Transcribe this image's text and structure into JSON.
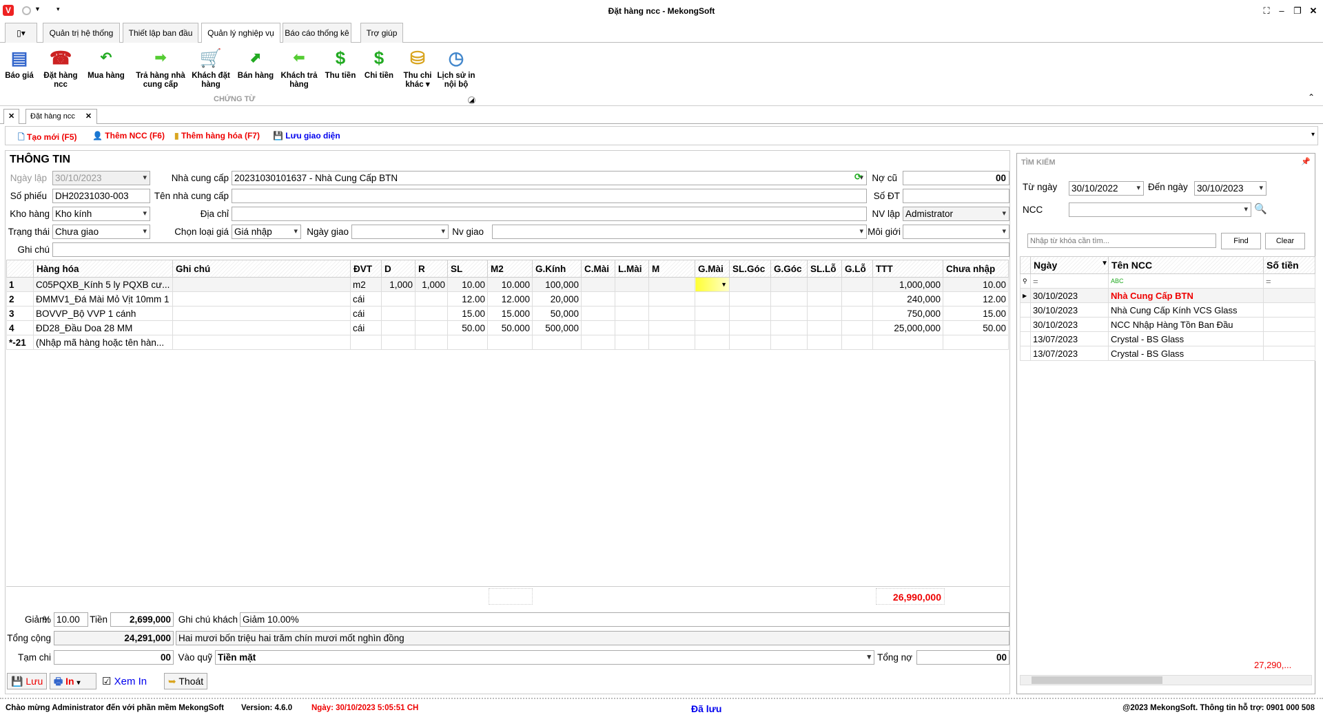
{
  "window": {
    "title": "Đặt hàng ncc - MekongSoft"
  },
  "menu_tabs": [
    "Quản trị hệ thống",
    "Thiết lập ban đầu",
    "Quản lý nghiệp vụ",
    "Báo cáo thống kê",
    "Trợ giúp"
  ],
  "ribbon": {
    "items": [
      {
        "label": "Báo giá",
        "icon": "list-icon"
      },
      {
        "label": "Đặt hàng ncc",
        "icon": "telephone-icon"
      },
      {
        "label": "Mua hàng",
        "icon": "arrow-back-icon"
      },
      {
        "label": "Trả hàng nhà cung cấp",
        "icon": "arrow-right-icon"
      },
      {
        "label": "Khách đặt hàng",
        "icon": "cart-icon"
      },
      {
        "label": "Bán hàng",
        "icon": "arrow-up-icon"
      },
      {
        "label": "Khách trả hàng",
        "icon": "arrow-left-icon"
      },
      {
        "label": "Thu tiền",
        "icon": "dollar-plus-icon"
      },
      {
        "label": "Chi tiền",
        "icon": "dollar-minus-icon"
      },
      {
        "label": "Thu chi khác",
        "icon": "coins-icon"
      },
      {
        "label": "Lịch sử in nội bộ",
        "icon": "history-icon"
      }
    ],
    "group": "CHỨNG TỪ"
  },
  "doc_tab": "Đặt hàng ncc",
  "toolbar": {
    "new": "Tạo mới (F5)",
    "add_ncc": "Thêm NCC (F6)",
    "add_goods": "Thêm hàng hóa (F7)",
    "save_layout": "Lưu giao diện"
  },
  "form": {
    "section": "THÔNG TIN",
    "ngay_lap_label": "Ngày lập",
    "ngay_lap": "30/10/2023",
    "so_phieu_label": "Số phiếu",
    "so_phieu": "DH20231030-003",
    "kho_label": "Kho hàng",
    "kho": "Kho kính",
    "trang_thai_label": "Trạng thái",
    "trang_thai": "Chưa giao",
    "ghi_chu_label": "Ghi chú",
    "ncc_label": "Nhà cung cấp",
    "ncc": "20231030101637 - Nhà Cung Cấp BTN",
    "ten_ncc_label": "Tên nhà cung cấp",
    "dia_chi_label": "Địa chỉ",
    "loai_gia_label": "Chọn loại giá",
    "loai_gia": "Giá nhập",
    "ngay_giao_label": "Ngày giao",
    "nv_giao_label": "Nv giao",
    "no_cu_label": "Nợ cũ",
    "no_cu": "00",
    "so_dt_label": "Số ĐT",
    "nv_lap_label": "NV lập",
    "nv_lap": "Admistrator",
    "moi_gioi_label": "Môi giới"
  },
  "grid": {
    "columns": [
      "",
      "Hàng hóa",
      "Ghi chú",
      "ĐVT",
      "D",
      "R",
      "SL",
      "M2",
      "G.Kính",
      "C.Mài",
      "L.Mài",
      "M",
      "G.Mài",
      "SL.Góc",
      "G.Góc",
      "SL.Lỗ",
      "G.Lỗ",
      "TTT",
      "Chưa nhập"
    ],
    "rows": [
      [
        "1",
        "C05PQXB_Kính 5 ly PQXB cư...",
        "",
        "m2",
        "1,000",
        "1,000",
        "10.00",
        "10.000",
        "100,000",
        "",
        "",
        "",
        "",
        "",
        "",
        "",
        "",
        "1,000,000",
        "10.00"
      ],
      [
        "2",
        "ĐMMV1_Đá Mài Mỏ Vịt 10mm 1",
        "",
        "cái",
        "",
        "",
        "12.00",
        "12.000",
        "20,000",
        "",
        "",
        "",
        "",
        "",
        "",
        "",
        "",
        "240,000",
        "12.00"
      ],
      [
        "3",
        "BOVVP_Bộ VVP 1 cánh",
        "",
        "cái",
        "",
        "",
        "15.00",
        "15.000",
        "50,000",
        "",
        "",
        "",
        "",
        "",
        "",
        "",
        "",
        "750,000",
        "15.00"
      ],
      [
        "4",
        "ĐD28_Đầu Doa 28 MM",
        "",
        "cái",
        "",
        "",
        "50.00",
        "50.000",
        "500,000",
        "",
        "",
        "",
        "",
        "",
        "",
        "",
        "",
        "25,000,000",
        "50.00"
      ]
    ],
    "new_row": [
      "*-21",
      "(Nhập mã hàng hoặc tên hàn..."
    ],
    "total": "26,990,000"
  },
  "summary": {
    "giam_label": "Giảm:",
    "pct_label": "%",
    "giam_pct": "10.00",
    "tien_label": "Tiền",
    "tien": "2,699,000",
    "ghi_chu_khach_label": "Ghi chú khách",
    "ghi_chu_khach": "Giảm 10.00%",
    "tong_cong_label": "Tổng cộng",
    "tong_cong": "24,291,000",
    "bang_chu": "Hai mươi bốn triệu hai trăm chín mươi mốt nghìn đồng",
    "tam_chi_label": "Tạm chi",
    "tam_chi": "00",
    "vao_quy_label": "Vào quỹ",
    "vao_quy": "Tiền mặt",
    "tong_no_label": "Tổng nợ",
    "tong_no": "00"
  },
  "buttons": {
    "save": "Lưu",
    "print": "In",
    "preview": "Xem In",
    "exit": "Thoát"
  },
  "search": {
    "title": "TÌM KIẾM",
    "tu_ngay_label": "Từ ngày",
    "tu_ngay": "30/10/2022",
    "den_ngay_label": "Đến ngày",
    "den_ngay": "30/10/2023",
    "ncc_label": "NCC",
    "placeholder": "Nhập từ khóa cần tìm...",
    "find": "Find",
    "clear": "Clear",
    "columns": [
      "Ngày",
      "Tên NCC",
      "Số tiền"
    ],
    "rows": [
      [
        "30/10/2023",
        "Nhà Cung Cấp BTN",
        ""
      ],
      [
        "30/10/2023",
        "Nhà Cung Cấp Kính VCS Glass",
        ""
      ],
      [
        "30/10/2023",
        "NCC Nhập Hàng Tồn Ban Đầu",
        ""
      ],
      [
        "13/07/2023",
        "Crystal - BS Glass",
        ""
      ],
      [
        "13/07/2023",
        "Crystal - BS Glass",
        ""
      ]
    ],
    "total": "27,290,..."
  },
  "status": {
    "welcome": "Chào mừng Administrator đến với phần mềm MekongSoft",
    "version": "Version: 4.6.0",
    "date": "Ngày: 30/10/2023 5:05:51 CH",
    "saved": "Đã lưu",
    "copyright": "@2023 MekongSoft. Thông tin hỗ trợ: 0901 000 508"
  },
  "colors": {
    "accent_red": "#e00000",
    "link_blue": "#0000ee",
    "highlight": "#ffff33"
  }
}
